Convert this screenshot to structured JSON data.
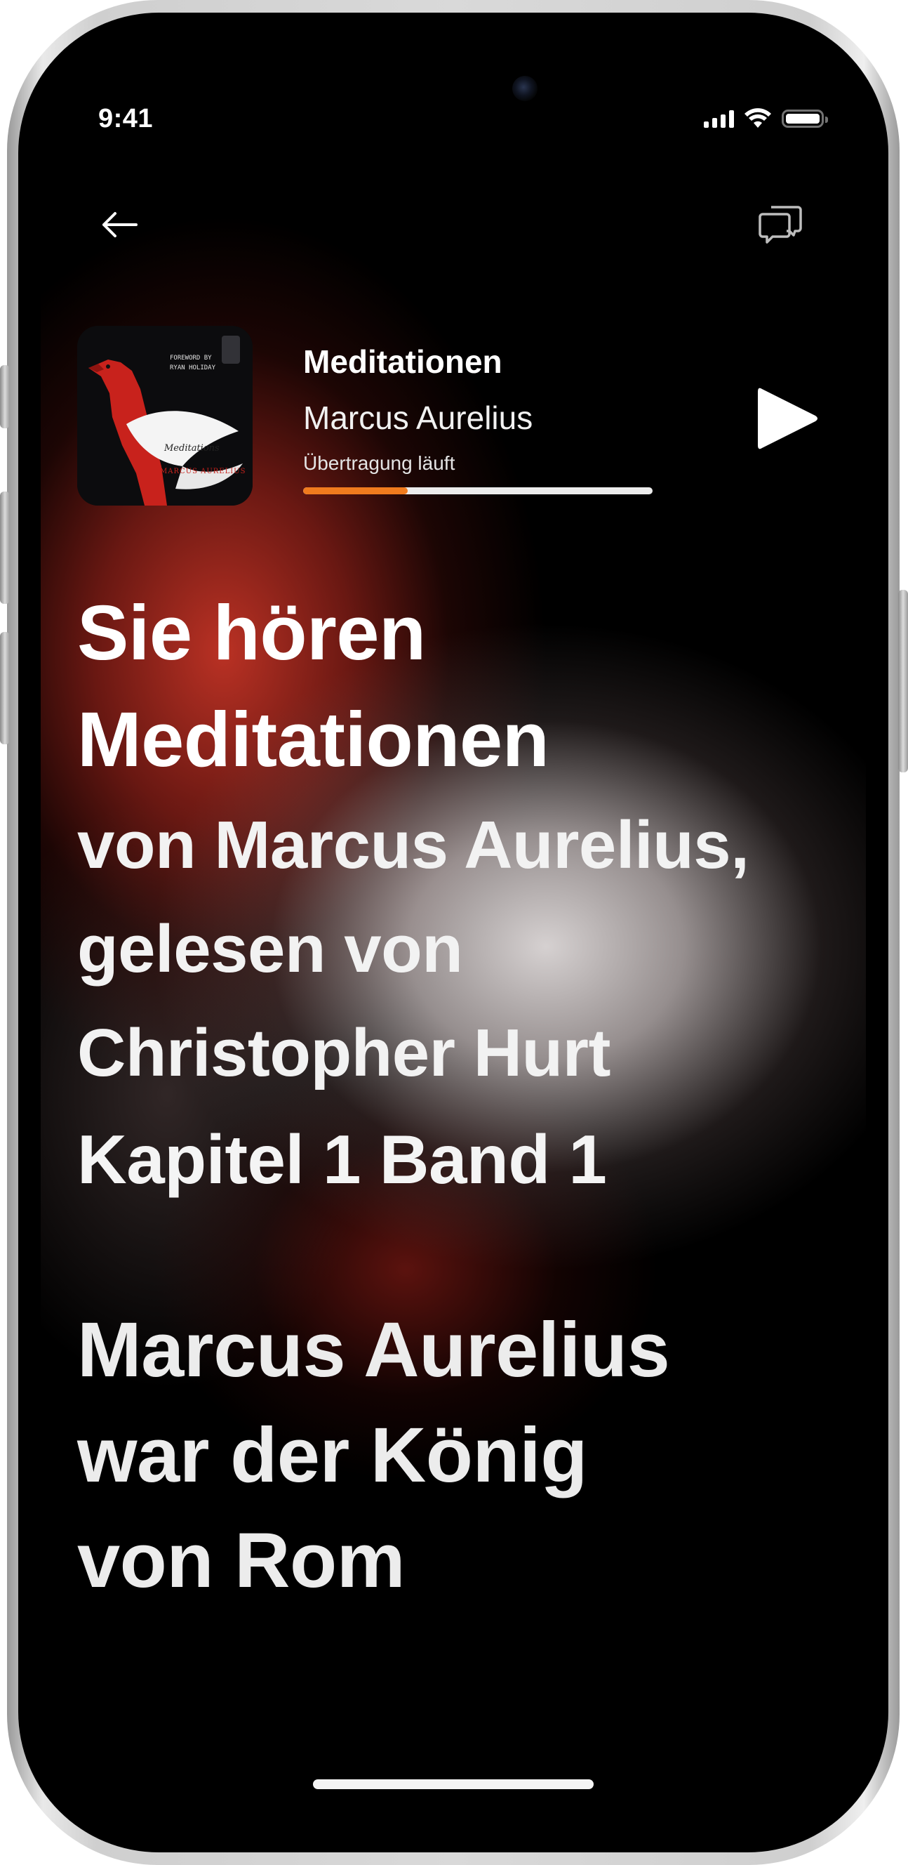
{
  "status_bar": {
    "time": "9:41"
  },
  "nav": {
    "back_icon": "arrow-left-icon",
    "chat_icon": "chat-bubbles-icon"
  },
  "now_playing": {
    "title": "Meditationen",
    "author": "Marcus Aurelius",
    "status": "Übertragung läuft",
    "progress": 0.3,
    "progress_color": "#f07b1e",
    "play_icon": "play-icon",
    "cover": {
      "foreword_line1": "FOREWORD BY",
      "foreword_line2": "RYAN HOLIDAY",
      "title": "Meditations",
      "author": "MARCUS AURELIUS"
    }
  },
  "transcript": {
    "heading_line1": "Sie hören",
    "heading_line2": "Meditationen",
    "sub_line1": "von Marcus Aurelius,",
    "sub_line2": "gelesen von",
    "sub_line3": "Christopher Hurt",
    "chapter": "Kapitel 1 Band 1",
    "body_line1": "Marcus Aurelius",
    "body_line2": "war der König",
    "body_line3": "von Rom"
  },
  "colors": {
    "accent": "#f07b1e",
    "red_glow": "#c43426"
  }
}
